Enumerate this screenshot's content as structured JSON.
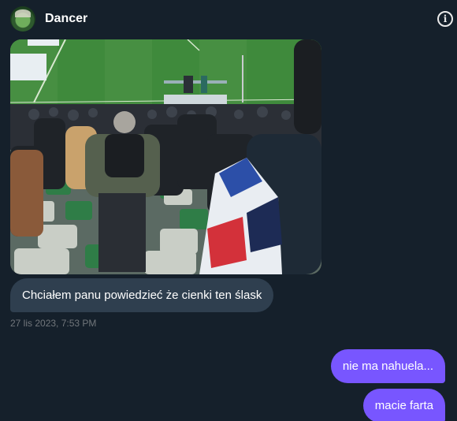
{
  "conversation": {
    "contact_name": "Dancer",
    "avatar_icon": "user-avatar",
    "info_icon": "info-icon"
  },
  "messages": {
    "photo": {
      "type": "image",
      "description_icon": "stadium-photo"
    },
    "incoming_text": "Chciałem panu powiedzieć że cienki ten ślask",
    "incoming_timestamp": "27 lis 2023, 7:53 PM",
    "outgoing": [
      "nie ma nahuela...",
      "macie farta"
    ]
  },
  "colors": {
    "background": "#15202b",
    "incoming_bubble": "#2f3f4f",
    "outgoing_bubble": "#7856ff",
    "timestamp": "#71767b"
  }
}
